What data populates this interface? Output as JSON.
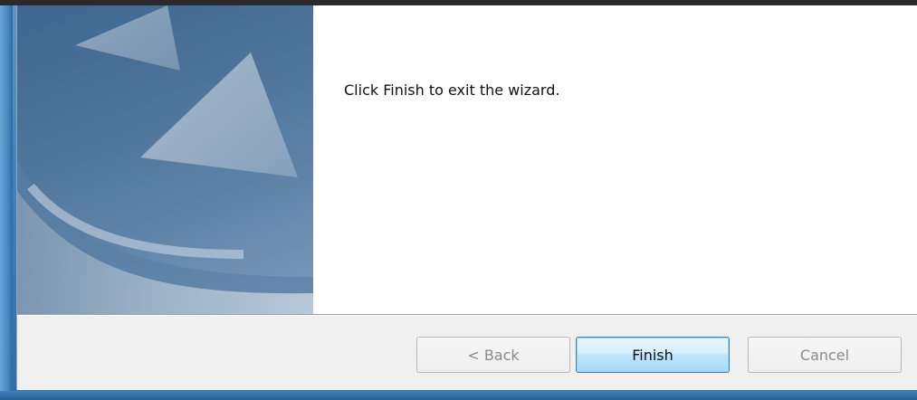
{
  "wizard": {
    "message": "Click Finish to exit the wizard.",
    "buttons": {
      "back_label": "< Back",
      "finish_label": "Finish",
      "cancel_label": "Cancel"
    },
    "button_states": {
      "back_enabled": false,
      "finish_enabled": true,
      "cancel_enabled": false
    }
  },
  "colors": {
    "frame_blue": "#3f7fb8",
    "banner_blue": "#4d7399",
    "button_bar": "#f0f0f0",
    "default_button_border": "#3c7fb1"
  },
  "icons": {
    "banner": "sailboat-banner-graphic"
  }
}
